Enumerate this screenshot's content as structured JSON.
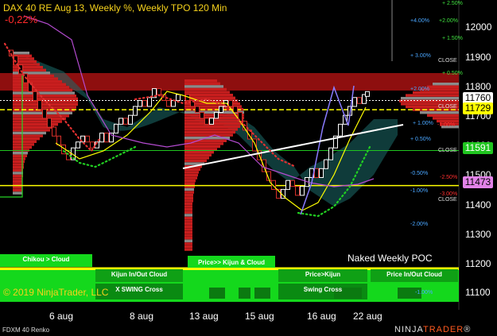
{
  "header": {
    "title": "DAX 40 RE Aug 13, Weekly %, Weekly TPO 120 Min",
    "change": "-0,22%"
  },
  "footer": {
    "copyright": "© 2019 NinjaTrader, LLC",
    "instrument": "FDXM 40 Renko",
    "brand_prefix": "NINJA",
    "brand_suffix": "TRADER"
  },
  "annotation": {
    "poc": "Naked Weekly POC"
  },
  "xaxis": [
    "6 aug",
    "8 aug",
    "13 aug",
    "15 aug",
    "16 aug",
    "22 aug"
  ],
  "yaxis": [
    "12000",
    "11900",
    "11800",
    "11700",
    "11600",
    "11500",
    "11400",
    "11300",
    "11200",
    "11100"
  ],
  "price_boxes": [
    {
      "value": "11760",
      "bg": "#ffffff",
      "fg": "#000000"
    },
    {
      "value": "11729",
      "bg": "#ffff00",
      "fg": "#000000"
    },
    {
      "value": "11591",
      "bg": "#1fc51f",
      "fg": "#ffffff"
    },
    {
      "value": "11473",
      "bg": "#e283e8",
      "fg": "#000000"
    }
  ],
  "pct_levels": [
    {
      "text": "+ 2.50%",
      "color": "#3fe03f"
    },
    {
      "text": "+2.00%",
      "color": "#3fe03f"
    },
    {
      "text": "+4.00%",
      "color": "#4aa6ff"
    },
    {
      "text": "+ 1.50%",
      "color": "#3fe03f"
    },
    {
      "text": "+ 3.00%",
      "color": "#4aa6ff"
    },
    {
      "text": "+ 0.50%",
      "color": "#3fe03f"
    },
    {
      "text": "+2.00%",
      "color": "#4aa6ff"
    },
    {
      "text": "+ 1.00%",
      "color": "#4aa6ff"
    },
    {
      "text": "-1.00%",
      "color": "#ff3030"
    },
    {
      "text": "+ 0.50%",
      "color": "#4aa6ff"
    },
    {
      "text": "-0.50%",
      "color": "#4aa6ff"
    },
    {
      "text": "-2.50%",
      "color": "#ff3030"
    },
    {
      "text": "-1.00%",
      "color": "#4aa6ff"
    },
    {
      "text": "-3.00%",
      "color": "#ff3030"
    },
    {
      "text": "-2.00%",
      "color": "#4aa6ff"
    },
    {
      "text": "-1.00%",
      "color": "#4aa6ff"
    }
  ],
  "close_labels": [
    "CLOSE",
    "CLOSE",
    "CLOSE",
    "CLOSE"
  ],
  "signal_bars": [
    {
      "text": "Chikou > Cloud"
    },
    {
      "text": "Kijun In/Out Cloud"
    },
    {
      "text": "Price>> Kijun & Cloud"
    },
    {
      "text": "Price>Kijun"
    },
    {
      "text": "Price In/Out Cloud"
    },
    {
      "text": "X SWING Cross"
    },
    {
      "text": "Swing Cross"
    }
  ],
  "chart_data": {
    "type": "line",
    "x_labels": [
      "6 aug",
      "8 aug",
      "13 aug",
      "15 aug",
      "16 aug",
      "22 aug"
    ],
    "ylim": [
      11050,
      12050
    ],
    "yticks": [
      12000,
      11900,
      11800,
      11700,
      11600,
      11500,
      11400,
      11300,
      11200,
      11100
    ],
    "horizontal_levels": [
      11760,
      11729,
      11591,
      11473
    ],
    "colors": {
      "bull": "#ffffff",
      "bear": "#d7302a",
      "profile": "#c81e1e",
      "kijun": "#ffff00",
      "cloud": "#1c6b6a"
    }
  }
}
